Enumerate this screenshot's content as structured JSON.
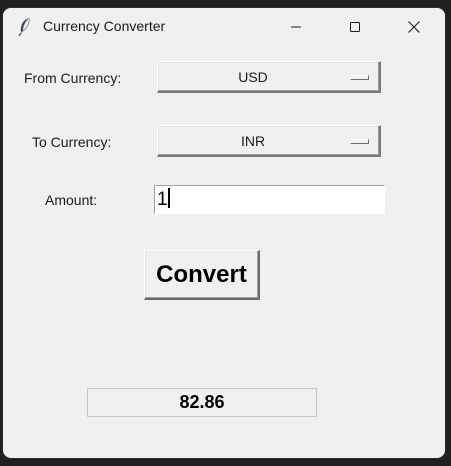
{
  "window": {
    "title": "Currency Converter",
    "icons": {
      "app": "feather-icon",
      "minimize": "minimize-icon",
      "maximize": "maximize-icon",
      "close": "close-icon"
    }
  },
  "form": {
    "from_label": "From Currency:",
    "from_value": "USD",
    "to_label": "To Currency:",
    "to_value": "INR",
    "amount_label": "Amount:",
    "amount_value": "1"
  },
  "actions": {
    "convert_label": "Convert"
  },
  "result": {
    "value": "82.86"
  }
}
